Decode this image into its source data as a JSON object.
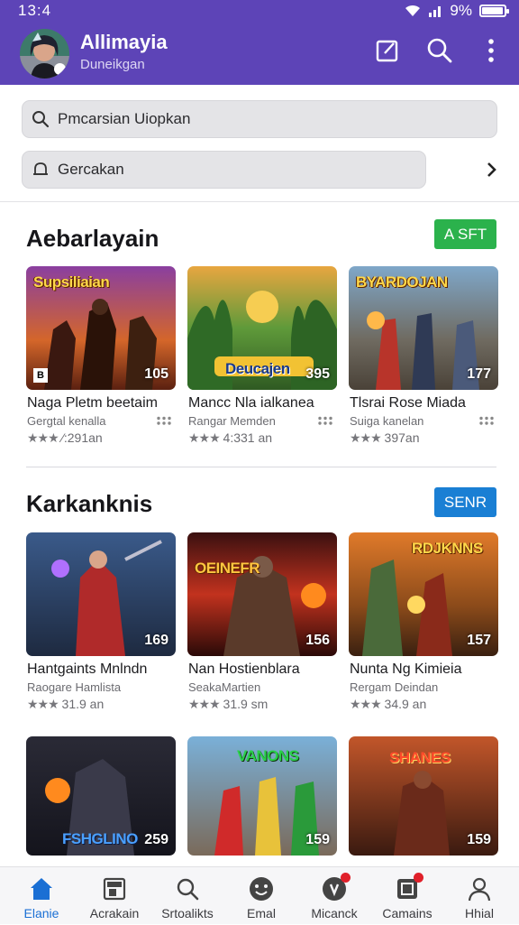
{
  "status": {
    "time": "13:4",
    "battery": "9%",
    "battery_level": 0.9
  },
  "header": {
    "title": "Allimayia",
    "subtitle": "Duneikgan",
    "compose_icon": "compose-icon",
    "search_icon": "search-icon",
    "more_icon": "more-vert-icon"
  },
  "search": {
    "primary": "Pmcarsian Uiopkan",
    "secondary": "Gercakan"
  },
  "sections": [
    {
      "title": "Aebarlayain",
      "action": "A SFT",
      "action_color": "#2bb24c",
      "cards": [
        {
          "overlay": "Supsiliaian",
          "corner": "B",
          "count": "105",
          "name": "Naga Pletm beetaim",
          "developer": "Gergtal kenalla",
          "stars": "★★★",
          "rating": "⁄:291an"
        },
        {
          "overlay": "Deucajen",
          "corner": "",
          "count": "395",
          "name": "Mancc Nla ialkanea",
          "developer": "Rangar Memden",
          "stars": "★★★",
          "rating": "4:331 an"
        },
        {
          "overlay": "BYARDOJAN",
          "corner": "",
          "count": "177",
          "name": "Tlsrai Rose Miada",
          "developer": "Suiga kanelan",
          "stars": "★★★",
          "rating": "397an"
        }
      ]
    },
    {
      "title": "Karkanknis",
      "action": "SENR",
      "action_color": "#1a7fd4",
      "cards": [
        {
          "overlay": "",
          "corner": "",
          "count": "169",
          "name": "Hantgaints Mnlndn",
          "developer": "Raogare Hamlista",
          "stars": "★★★",
          "rating": "31.9 an"
        },
        {
          "overlay": "OEINEFR",
          "corner": "",
          "count": "156",
          "name": "Nan Hostienblara",
          "developer": "SeakaMartien",
          "stars": "★★★",
          "rating": "31.9 sm"
        },
        {
          "overlay": "RDJKNNS",
          "corner": "",
          "count": "157",
          "name": "Nunta Ng Kimieia",
          "developer": "Rergam Deindan",
          "stars": "★★★",
          "rating": "34.9 an"
        }
      ]
    },
    {
      "title": "",
      "cards": [
        {
          "overlay": "FSHGLINO",
          "corner": "",
          "count": "259"
        },
        {
          "overlay": "VANONS",
          "corner": "",
          "count": "159"
        },
        {
          "overlay": "SHANES",
          "corner": "",
          "count": "159"
        }
      ]
    }
  ],
  "nav": [
    {
      "label": "Elanie",
      "icon": "home-icon",
      "active": true,
      "dot": false
    },
    {
      "label": "Acrakain",
      "icon": "window-icon",
      "active": false,
      "dot": false
    },
    {
      "label": "Srtoalikts",
      "icon": "search-icon",
      "active": false,
      "dot": false
    },
    {
      "label": "Emal",
      "icon": "emoji-icon",
      "active": false,
      "dot": false
    },
    {
      "label": "Micanck",
      "icon": "chat-icon",
      "active": false,
      "dot": true
    },
    {
      "label": "Camains",
      "icon": "game-icon",
      "active": false,
      "dot": true
    },
    {
      "label": "Hhial",
      "icon": "profile-icon",
      "active": false,
      "dot": false
    }
  ],
  "colors": {
    "appbar": "#5d44b7",
    "nav_active": "#1a6fd4"
  }
}
